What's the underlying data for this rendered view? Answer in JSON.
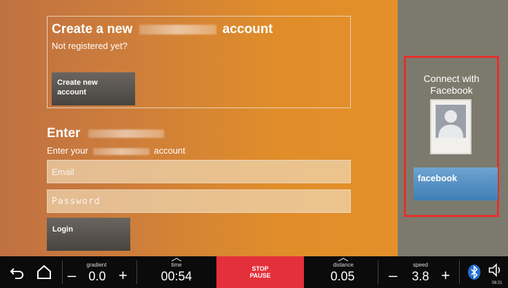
{
  "create": {
    "title_prefix": "Create a new",
    "title_suffix": "account",
    "subtitle": "Not registered yet?",
    "button_line1": "Create new",
    "button_line2": "account"
  },
  "enter": {
    "title": "Enter",
    "sub_prefix": "Enter your",
    "sub_suffix": "account",
    "email_placeholder": "Email",
    "password_placeholder": "Password",
    "login_label": "Login"
  },
  "facebook": {
    "connect_line1": "Connect with",
    "connect_line2": "Facebook",
    "button_label": "facebook"
  },
  "statusbar": {
    "gradient_label": "gradient",
    "gradient_value": "0.0",
    "time_label": "time",
    "time_value": "00:54",
    "stop_label": "STOP",
    "pause_label": "PAUSE",
    "distance_label": "distance",
    "distance_value": "0.05",
    "speed_label": "speed",
    "speed_value": "3.8",
    "minus": "–",
    "plus": "+",
    "clock": "08:21"
  },
  "colors": {
    "highlight_border": "#e4302a",
    "stop_bg": "#e4303a",
    "facebook_button": "#4a8ac4"
  },
  "icons": [
    "back-arrow-icon",
    "home-icon",
    "bluetooth-icon",
    "speaker-icon",
    "chevron-up-icon",
    "avatar-placeholder-icon"
  ]
}
